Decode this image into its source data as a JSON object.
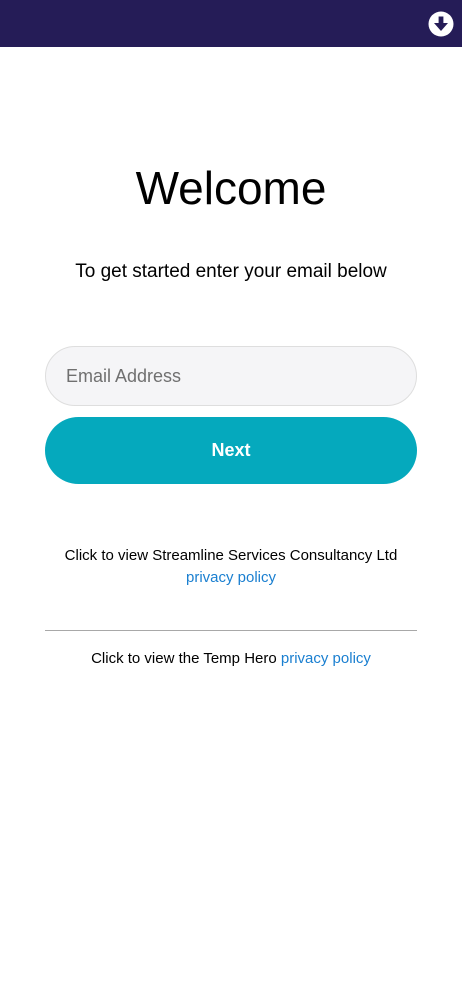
{
  "header": {
    "download_icon": "arrow-down-circle-icon",
    "background_color": "#251c57"
  },
  "main": {
    "title": "Welcome",
    "subtitle": "To get started enter your email below",
    "email_placeholder": "Email Address",
    "email_value": "",
    "next_label": "Next",
    "accent_color": "#05a9bd"
  },
  "policies": {
    "company_text": "Click to view Streamline Services Consultancy Ltd",
    "company_link": "privacy policy",
    "temphero_text": "Click to view the Temp Hero",
    "temphero_link": "privacy policy",
    "link_color": "#1a7fd0"
  }
}
